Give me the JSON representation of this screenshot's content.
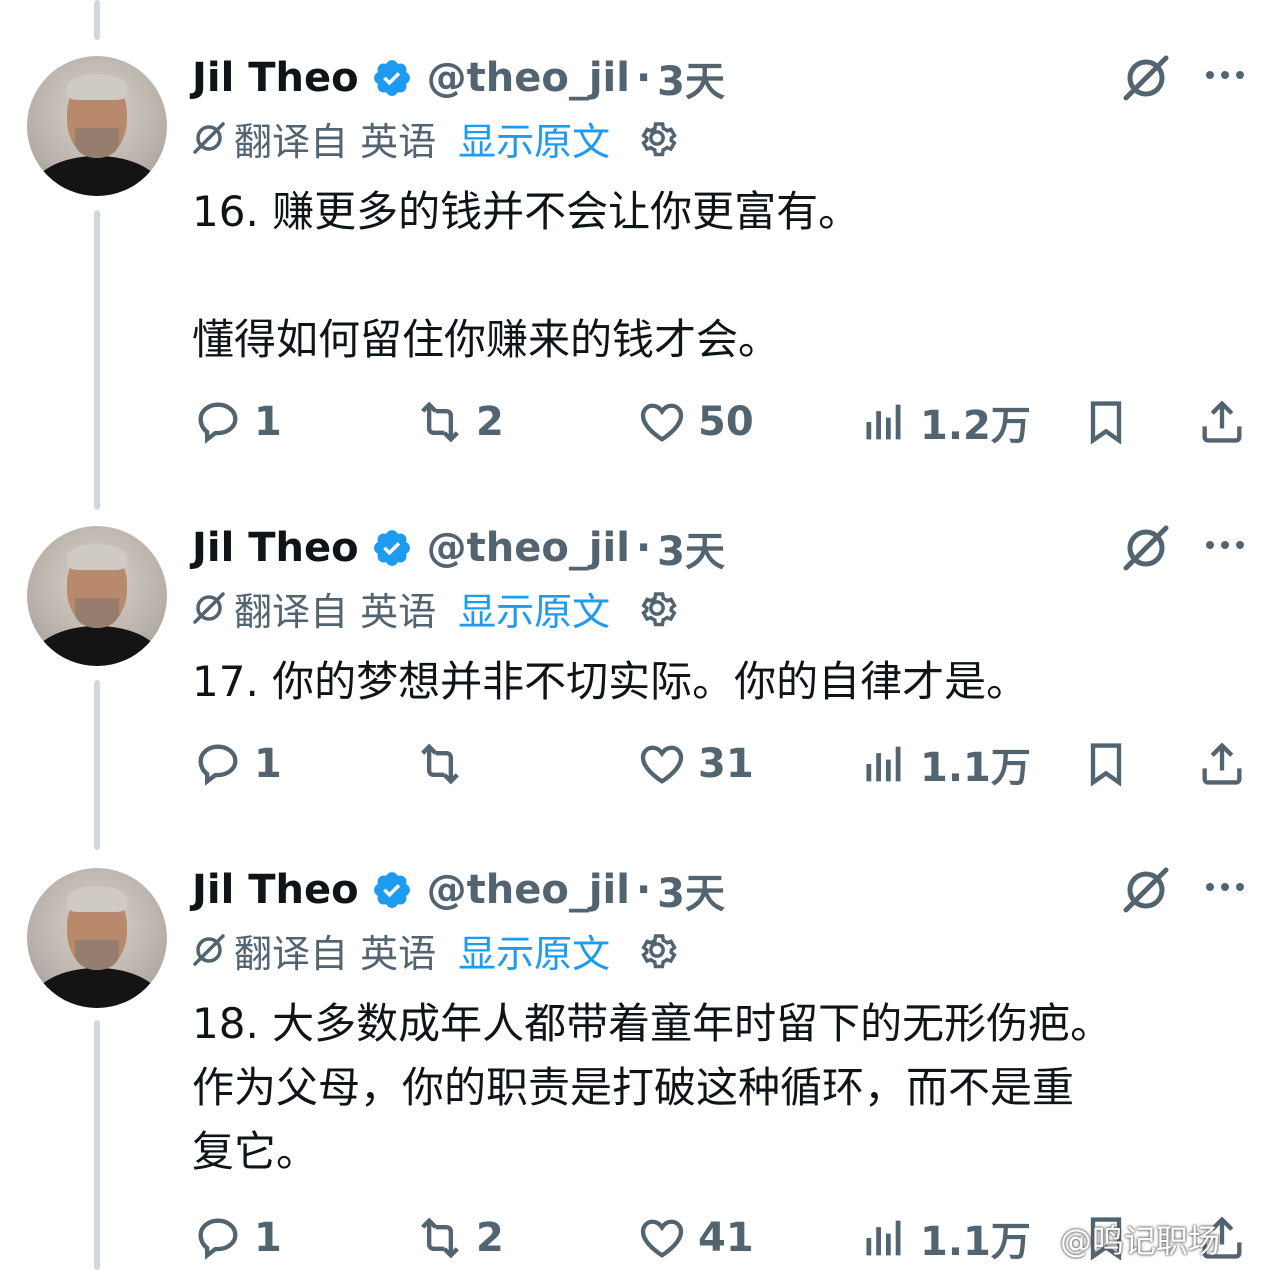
{
  "tweets": [
    {
      "name": "Jil Theo",
      "handle": "@theo_jil",
      "separator": "·",
      "time": "3天",
      "translated_label": "翻译自 英语",
      "show_original": "显示原文",
      "lines": [
        "16. 赚更多的钱并不会让你更富有。",
        "",
        "懂得如何留住你赚来的钱才会。"
      ],
      "replies": "1",
      "retweets": "2",
      "likes": "50",
      "views": "1.2万"
    },
    {
      "name": "Jil Theo",
      "handle": "@theo_jil",
      "separator": "·",
      "time": "3天",
      "translated_label": "翻译自 英语",
      "show_original": "显示原文",
      "lines": [
        "17. 你的梦想并非不切实际。你的自律才是。"
      ],
      "replies": "1",
      "retweets": "",
      "likes": "31",
      "views": "1.1万"
    },
    {
      "name": "Jil Theo",
      "handle": "@theo_jil",
      "separator": "·",
      "time": "3天",
      "translated_label": "翻译自 英语",
      "show_original": "显示原文",
      "lines": [
        "18. 大多数成年人都带着童年时留下的无形伤疤。",
        "作为父母，你的职责是打破这种循环，而不是重",
        "复它。"
      ],
      "replies": "1",
      "retweets": "2",
      "likes": "41",
      "views": "1.1万"
    }
  ],
  "watermark": "@鸣记职场",
  "colors": {
    "verified": "#1d9bf0",
    "link": "#1d9bf0",
    "muted": "#536471",
    "thread_line": "#cfd9de"
  }
}
